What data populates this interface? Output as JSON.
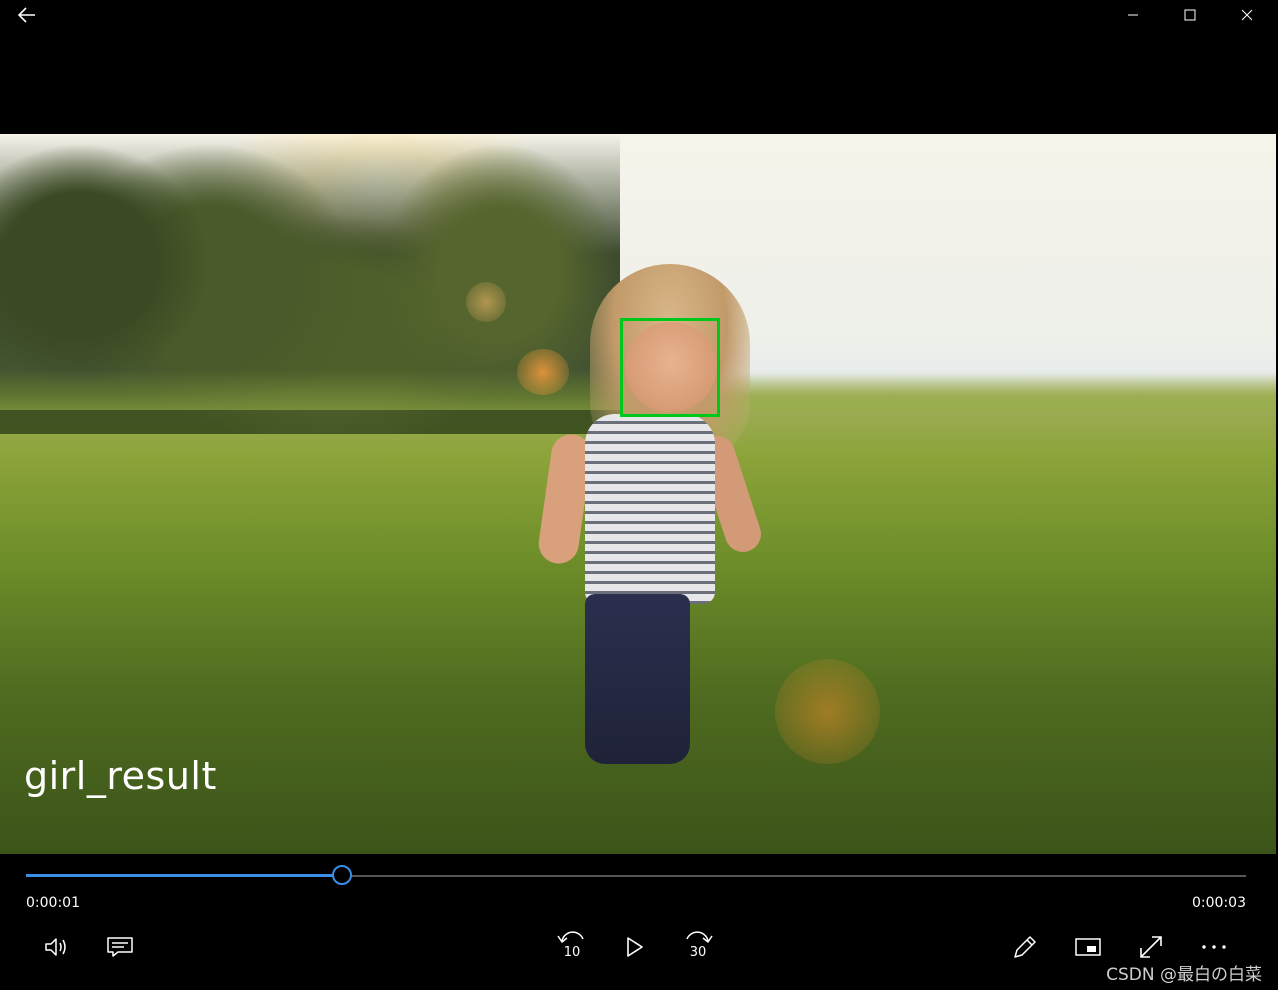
{
  "window": {
    "back_icon": "arrow-left-icon",
    "minimize_icon": "minimize-icon",
    "maximize_icon": "maximize-icon",
    "close_icon": "close-icon"
  },
  "video": {
    "title": "girl_result",
    "overlay_color": "#00c81a"
  },
  "playback": {
    "current_time": "0:00:01",
    "total_time": "0:00:03",
    "progress_fraction": 0.26,
    "accent_color": "#3b8ee6"
  },
  "controls": {
    "skip_back_label": "10",
    "skip_forward_label": "30",
    "icons": [
      "volume-icon",
      "subtitles-icon",
      "skip-back-10-icon",
      "play-icon",
      "skip-forward-30-icon",
      "edit-pencil-icon",
      "mini-view-icon",
      "fullscreen-icon",
      "more-icon"
    ]
  },
  "watermark": "CSDN @最白の白菜"
}
